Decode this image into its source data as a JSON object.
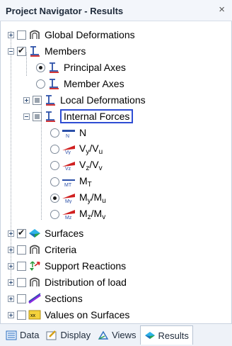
{
  "window": {
    "title": "Project Navigator - Results",
    "close_glyph": "×"
  },
  "tree": {
    "global_deformations": "Global Deformations",
    "members": "Members",
    "principal_axes": "Principal Axes",
    "member_axes": "Member Axes",
    "local_deformations": "Local Deformations",
    "internal_forces": "Internal Forces",
    "forces": {
      "n": "N",
      "vy_main": "V",
      "vy_sub1": "y",
      "vy_sep": "/V",
      "vy_sub2": "u",
      "vz_main": "V",
      "vz_sub1": "z",
      "vz_sep": "/V",
      "vz_sub2": "v",
      "mt_main": "M",
      "mt_sub1": "T",
      "my_main": "M",
      "my_sub1": "y",
      "my_sep": "/M",
      "my_sub2": "u",
      "mz_main": "M",
      "mz_sub1": "z",
      "mz_sep": "/M",
      "mz_sub2": "v"
    },
    "surfaces": "Surfaces",
    "criteria": "Criteria",
    "support_reactions": "Support Reactions",
    "distribution_of_load": "Distribution of load",
    "sections": "Sections",
    "values_on_surfaces": "Values on Surfaces"
  },
  "icons": {
    "icon_n": "N",
    "icon_vy": "Vy",
    "icon_vz": "Vz",
    "icon_mt": "MT",
    "icon_my": "My",
    "icon_mz": "Mz",
    "values_badge": "xx"
  },
  "tabs": {
    "data": "Data",
    "display": "Display",
    "views": "Views",
    "results": "Results"
  },
  "colors": {
    "accent": "#2e4dd4",
    "member_red": "#d02020",
    "member_blue": "#2a4fa8"
  }
}
